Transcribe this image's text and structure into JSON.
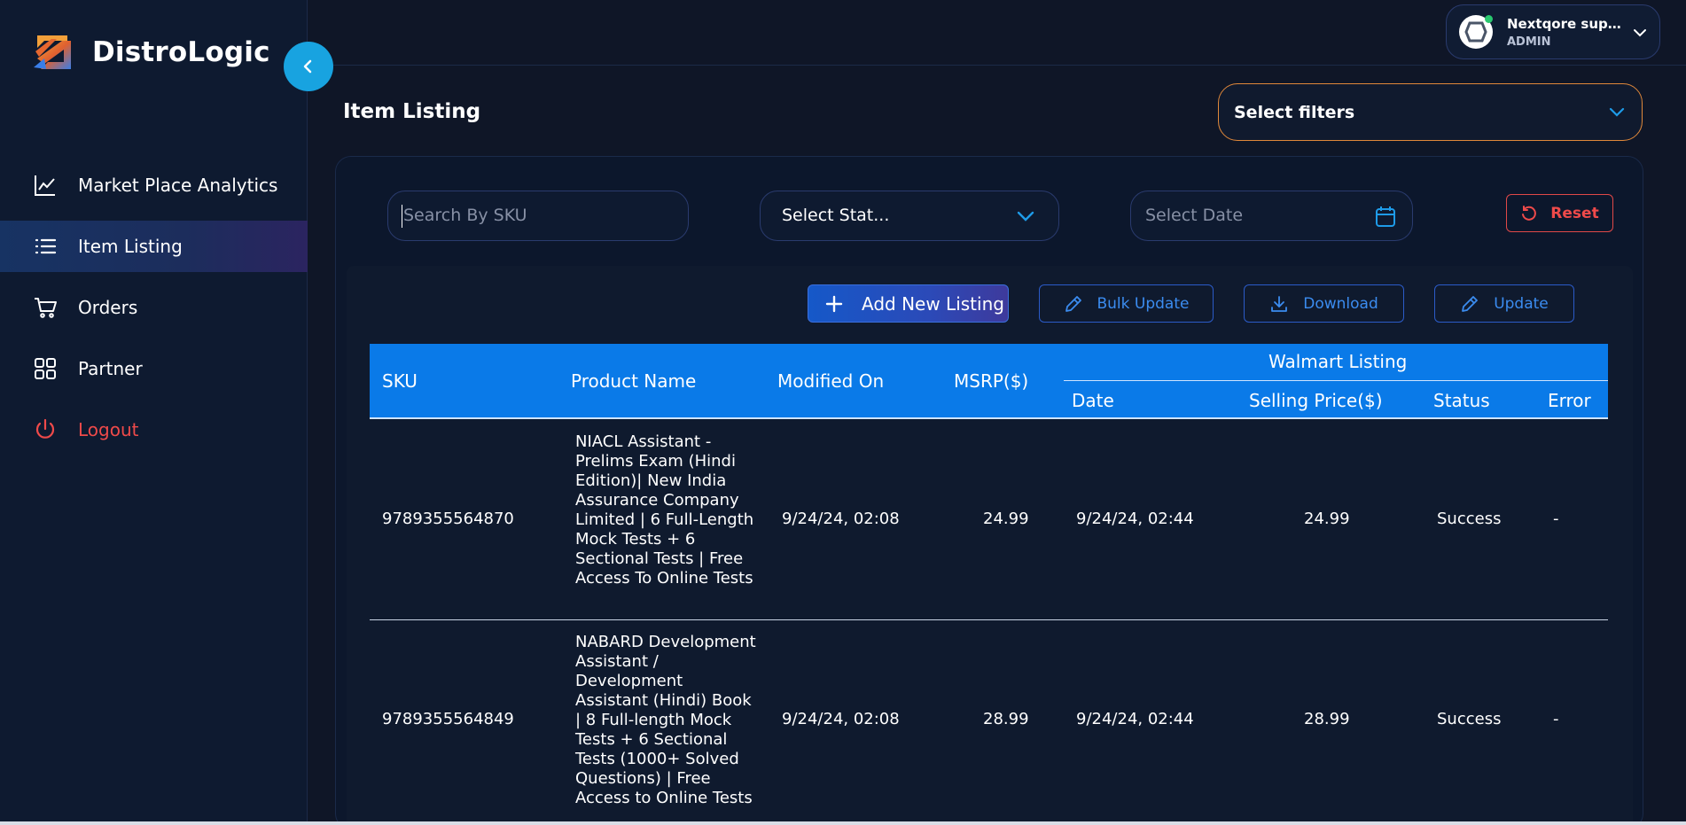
{
  "brand": {
    "name": "DistroLogic"
  },
  "sidebar": {
    "items": [
      {
        "label": "Market Place Analytics",
        "icon": "chart-icon"
      },
      {
        "label": "Item Listing",
        "icon": "list-icon",
        "active": true
      },
      {
        "label": "Orders",
        "icon": "cart-icon"
      },
      {
        "label": "Partner",
        "icon": "grid-icon"
      },
      {
        "label": "Logout",
        "icon": "power-icon"
      }
    ]
  },
  "user": {
    "name": "Nextqore supp...",
    "role": "ADMIN"
  },
  "page": {
    "title": "Item Listing"
  },
  "filters": {
    "select_filters": "Select filters",
    "search_placeholder": "Search By SKU",
    "status_value": "Select Stat...",
    "date_placeholder": "Select Date",
    "reset_label": "Reset"
  },
  "actions": {
    "add_new": "Add New Listing",
    "bulk_update": "Bulk Update",
    "download": "Download",
    "update": "Update"
  },
  "table": {
    "headers": {
      "sku": "SKU",
      "product_name": "Product Name",
      "modified_on": "Modified On",
      "msrp": "MSRP($)",
      "group": "Walmart Listing",
      "date": "Date",
      "selling_price": "Selling Price($)",
      "status": "Status",
      "error": "Error"
    },
    "rows": [
      {
        "sku": "9789355564870",
        "product_name": "NIACL Assistant - Prelims Exam (Hindi Edition)| New India Assurance Company Limited | 6 Full-Length Mock Tests + 6 Sectional Tests | Free Access To Online Tests",
        "modified_on": "9/24/24, 02:08",
        "msrp": "24.99",
        "date": "9/24/24, 02:44",
        "selling_price": "24.99",
        "status": "Success",
        "error": "-"
      },
      {
        "sku": "9789355564849",
        "product_name": "NABARD Development Assistant / Development Assistant (Hindi) Book | 8 Full-length Mock Tests + 6 Sectional Tests (1000+ Solved Questions) | Free Access to Online Tests",
        "modified_on": "9/24/24, 02:08",
        "msrp": "28.99",
        "date": "9/24/24, 02:44",
        "selling_price": "28.99",
        "status": "Success",
        "error": "-"
      }
    ]
  },
  "colors": {
    "background": "#0f1627",
    "sidebar": "#0e1a30",
    "accent_blue": "#0a7ae8",
    "collapse_button": "#18a3e0",
    "filter_border": "#e0883a",
    "danger": "#ef4a4a"
  }
}
